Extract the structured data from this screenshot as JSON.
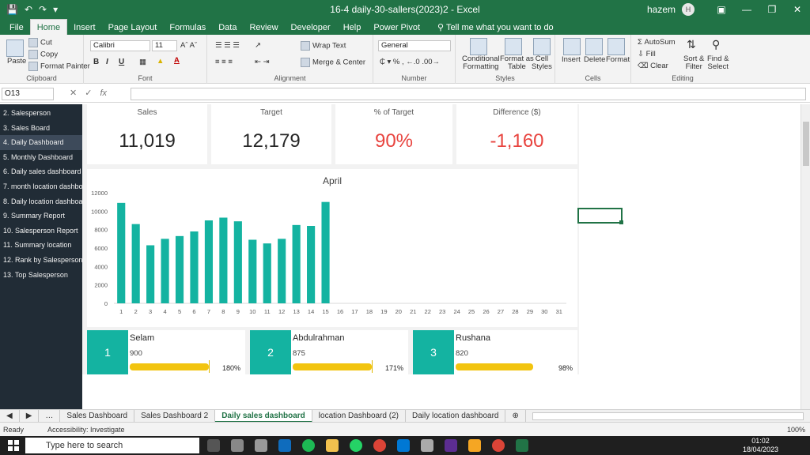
{
  "window": {
    "title": "16-4 daily-30-sallers(2023)2  -  Excel",
    "user_name": "hazem",
    "avatar_initial": "H"
  },
  "ribbon_tabs": [
    "File",
    "Home",
    "Insert",
    "Page Layout",
    "Formulas",
    "Data",
    "Review",
    "Developer",
    "Help",
    "Power Pivot"
  ],
  "tell_me": "Tell me what you want to do",
  "ribbon": {
    "clipboard": {
      "paste": "Paste",
      "cut": "Cut",
      "copy": "Copy",
      "format_painter": "Format Painter",
      "label": "Clipboard"
    },
    "font": {
      "name": "Calibri",
      "size": "11",
      "bold": "B",
      "italic": "I",
      "underline": "U",
      "label": "Font"
    },
    "alignment": {
      "wrap_text": "Wrap Text",
      "merge_center": "Merge & Center",
      "label": "Alignment"
    },
    "number": {
      "format": "General",
      "label": "Number"
    },
    "styles": {
      "conditional": "Conditional",
      "formatting": "Formatting",
      "format_as": "Format as",
      "table": "Table",
      "cell": "Cell",
      "styles_word": "Styles",
      "label": "Styles"
    },
    "cells": {
      "insert": "Insert",
      "delete": "Delete",
      "format": "Format",
      "label": "Cells"
    },
    "editing": {
      "autosum": "AutoSum",
      "fill": "Fill",
      "clear": "Clear",
      "sort": "Sort &",
      "filter": "Filter",
      "find": "Find &",
      "select": "Select",
      "label": "Editing"
    }
  },
  "formula_bar": {
    "name_box": "O13",
    "fx": "fx",
    "value": ""
  },
  "nav": {
    "items": [
      "2. Salesperson",
      "3. Sales Board",
      "4. Daily Dashboard",
      "5. Monthly Dashboard",
      "6. Daily sales dashboard",
      "7. month location dashbo",
      "8. Daily location dashboa",
      "9. Summary Report",
      "10. Salesperson Report",
      "11. Summary location",
      "12. Rank by Salesperson",
      "13. Top Salesperson"
    ],
    "active_index": 2
  },
  "kpis": [
    {
      "label": "Sales",
      "value": "11,019",
      "color": "#262626"
    },
    {
      "label": "Target",
      "value": "12,179",
      "color": "#262626"
    },
    {
      "label": "% of Target",
      "value": "90%",
      "color": "#e8433e"
    },
    {
      "label": "Difference ($)",
      "value": "-1,160",
      "color": "#e8433e"
    }
  ],
  "chart_data": {
    "type": "bar",
    "title": "April",
    "x": [
      1,
      2,
      3,
      4,
      5,
      6,
      7,
      8,
      9,
      10,
      11,
      12,
      13,
      14,
      15,
      16,
      17,
      18,
      19,
      20,
      21,
      22,
      23,
      24,
      25,
      26,
      27,
      28,
      29,
      30,
      31
    ],
    "values": [
      10900,
      8600,
      6300,
      7000,
      7300,
      7800,
      9000,
      9300,
      8900,
      6900,
      6500,
      7000,
      8500,
      8400,
      11000,
      null,
      null,
      null,
      null,
      null,
      null,
      null,
      null,
      null,
      null,
      null,
      null,
      null,
      null,
      null,
      null
    ],
    "yticks": [
      0,
      2000,
      4000,
      6000,
      8000,
      10000,
      12000
    ],
    "ylim": [
      0,
      12000
    ],
    "bar_color": "#14b3a1",
    "grid": false
  },
  "ranking": [
    {
      "rank": "1",
      "name": "Selam",
      "value": "900",
      "pct_label": "180%",
      "fill": 1.0
    },
    {
      "rank": "2",
      "name": "Abdulrahman",
      "value": "875",
      "pct_label": "171%",
      "fill": 1.0
    },
    {
      "rank": "3",
      "name": "Rushana",
      "value": "820",
      "pct_label": "98%",
      "fill": 0.98
    }
  ],
  "sheet_tabs": [
    "Sales Dashboard",
    "Sales Dashboard 2",
    "Daily sales dashboard",
    "location Dashboard (2)",
    "Daily location dashboard"
  ],
  "active_sheet_index": 2,
  "status": {
    "ready": "Ready",
    "accessibility": "Accessibility: Investigate",
    "zoom": "100%"
  },
  "taskbar": {
    "search_placeholder": "Type here to search",
    "time": "01:02",
    "date": "18/04/2023"
  }
}
